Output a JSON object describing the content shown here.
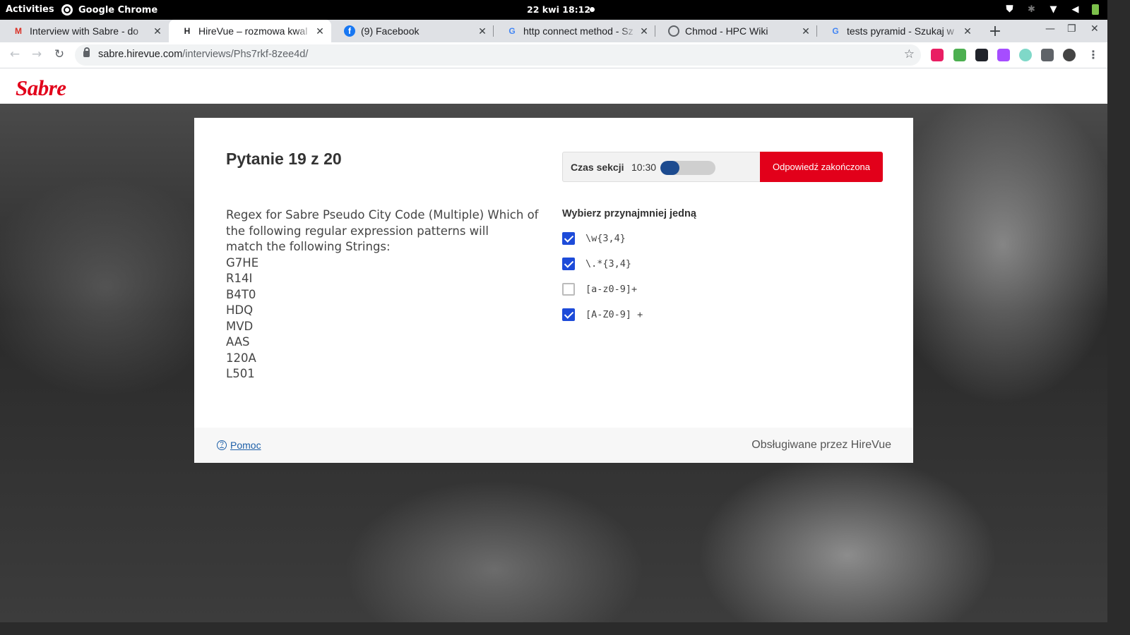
{
  "os": {
    "activities": "Activities",
    "app_name": "Google Chrome",
    "clock": "22 kwi  18:12"
  },
  "tabs": [
    {
      "favicon": "gmail-icon",
      "title": "Interview with Sabre - do",
      "active": false
    },
    {
      "favicon": "hirevue-icon",
      "title": "HireVue – rozmowa kwal",
      "active": true
    },
    {
      "favicon": "facebook-icon",
      "title": "(9) Facebook",
      "active": false
    },
    {
      "favicon": "google-icon",
      "title": "http connect method - Sz",
      "active": false
    },
    {
      "favicon": "globe-icon",
      "title": "Chmod - HPC Wiki",
      "active": false
    },
    {
      "favicon": "google-icon",
      "title": "tests pyramid - Szukaj w",
      "active": false
    }
  ],
  "address": {
    "host": "sabre.hirevue.com",
    "path": "/interviews/Phs7rkf-8zee4d/"
  },
  "brand": {
    "logo_text": "Sabre",
    "logo_color": "#e2001a"
  },
  "question": {
    "heading": "Pytanie 19 z 20",
    "text_lines": [
      "Regex for Sabre Pseudo City Code (Multiple) Which of",
      "the following regular expression patterns will",
      "match the following Strings:",
      "G7HE",
      "R14I",
      "B4T0",
      "HDQ",
      "MVD",
      "AAS",
      "120A",
      "L501"
    ]
  },
  "timer": {
    "label": "Czas sekcji",
    "value": "10:30",
    "progress_fraction": 0.35,
    "fill_color": "#1d4b8f"
  },
  "submit_label": "Odpowiedź zakończona",
  "choice": {
    "instruction": "Wybierz przynajmniej jedną",
    "options": [
      {
        "label": "\\w{3,4}",
        "checked": true
      },
      {
        "label": "\\.*{3,4}",
        "checked": true
      },
      {
        "label": "[a-z0-9]+",
        "checked": false
      },
      {
        "label": "[A-Z0-9] +",
        "checked": true
      }
    ]
  },
  "footer": {
    "help_label": "Pomoc",
    "powered_by": "Obsługiwane przez HireVue"
  },
  "colors": {
    "accent_red": "#e2001a",
    "checkbox_blue": "#1d4bd9",
    "link_blue": "#1d5fa8"
  }
}
